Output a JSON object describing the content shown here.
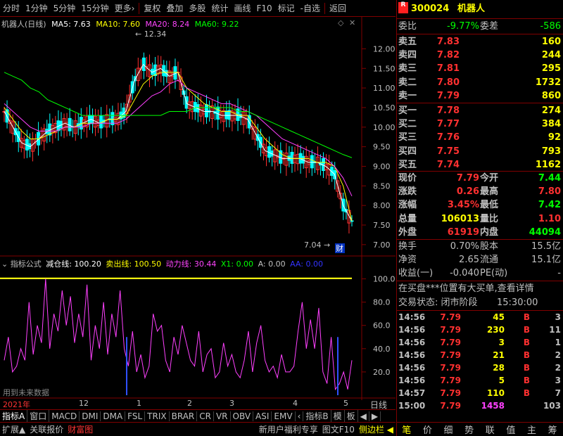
{
  "toolbar": {
    "items": [
      "分时",
      "1分钟",
      "5分钟",
      "15分钟",
      "更多›",
      "复权",
      "叠加",
      "多股",
      "统计",
      "画线",
      "F10",
      "标记",
      "-自选",
      "返回"
    ]
  },
  "chart": {
    "title": "机器人(日线)",
    "ma5": "MA5: 7.63",
    "ma10": "MA10: 7.60",
    "ma20": "MA20: 8.24",
    "ma60": "MA60: 9.22",
    "high_note": "12.34",
    "low_note": "7.04",
    "cai": "财",
    "yticks": [
      "12.00",
      "11.50",
      "11.00",
      "10.50",
      "10.00",
      "9.50",
      "9.00",
      "8.50",
      "8.00",
      "7.50",
      "7.00"
    ],
    "colors": {
      "ma5": "#ffffff",
      "ma10": "#ffff00",
      "ma20": "#ff40ff",
      "ma60": "#00ff00",
      "up": "#ff3030",
      "down": "#00ffff"
    }
  },
  "chart_data": {
    "type": "line",
    "title": "机器人(日线)",
    "ylim": [
      6.8,
      12.6
    ],
    "series": [
      {
        "name": "MA5",
        "values": [
          10.4,
          10.0,
          9.6,
          9.5,
          9.7,
          9.9,
          10.0,
          10.1,
          10.0,
          10.1,
          10.2,
          10.1,
          10.2,
          10.2,
          10.4,
          11.2,
          11.6,
          11.4,
          11.5,
          11.3,
          11.4,
          10.6,
          10.5,
          10.4,
          10.4,
          10.3,
          10.3,
          10.3,
          10.2,
          9.8,
          9.4,
          9.3,
          9.2,
          9.2,
          9.2,
          9.1,
          9.1,
          9.0,
          8.8,
          8.0,
          7.6
        ]
      },
      {
        "name": "MA10",
        "values": [
          10.5,
          10.2,
          9.9,
          9.7,
          9.7,
          9.8,
          9.9,
          10.0,
          10.0,
          10.1,
          10.1,
          10.1,
          10.2,
          10.2,
          10.3,
          10.7,
          11.1,
          11.3,
          11.4,
          11.4,
          11.4,
          11.0,
          10.8,
          10.6,
          10.5,
          10.4,
          10.4,
          10.3,
          10.3,
          10.0,
          9.7,
          9.5,
          9.3,
          9.2,
          9.2,
          9.2,
          9.1,
          9.1,
          9.0,
          8.5,
          7.6
        ]
      },
      {
        "name": "MA20",
        "values": [
          10.6,
          10.4,
          10.2,
          10.0,
          9.9,
          9.9,
          9.9,
          10.0,
          10.0,
          10.0,
          10.1,
          10.1,
          10.1,
          10.1,
          10.2,
          10.4,
          10.6,
          10.8,
          10.9,
          11.1,
          11.2,
          11.0,
          10.9,
          10.8,
          10.7,
          10.6,
          10.6,
          10.5,
          10.4,
          10.3,
          10.1,
          9.9,
          9.7,
          9.6,
          9.5,
          9.4,
          9.3,
          9.2,
          9.0,
          8.7,
          8.24
        ]
      },
      {
        "name": "MA60",
        "values": [
          11.4,
          11.3,
          11.2,
          11.0,
          10.9,
          10.7,
          10.6,
          10.5,
          10.4,
          10.3,
          10.3,
          10.3,
          10.3,
          10.3,
          10.3,
          10.3,
          10.3,
          10.3,
          10.3,
          10.4,
          10.4,
          10.4,
          10.5,
          10.5,
          10.5,
          10.5,
          10.5,
          10.4,
          10.4,
          10.3,
          10.2,
          10.1,
          10.0,
          9.9,
          9.8,
          9.7,
          9.6,
          9.5,
          9.4,
          9.3,
          9.22
        ]
      }
    ]
  },
  "indicator": {
    "label": "指标公式",
    "jc": "减仓线: 100.20",
    "mc": "卖出线: 100.50",
    "dl": "动力线: 30.44",
    "x1": "X1: 0.00",
    "a": "A: 0.00",
    "aa": "AA: 0.00",
    "yticks": [
      "100.0",
      "80.0",
      "60.0",
      "40.0",
      "20.0"
    ],
    "future": "用到未来数据",
    "values": [
      30,
      50,
      20,
      25,
      40,
      30,
      80,
      35,
      60,
      45,
      100,
      40,
      70,
      55,
      90,
      60,
      85,
      45,
      70,
      50,
      95,
      30,
      60,
      40,
      80,
      35,
      70,
      50,
      90,
      40,
      25,
      55,
      20,
      35,
      15,
      25,
      70,
      55,
      60,
      30,
      20,
      50,
      35,
      60,
      45,
      30,
      25,
      55,
      20,
      35,
      40,
      15,
      20,
      45,
      25,
      35,
      20,
      15,
      30,
      55,
      20,
      45,
      60,
      30,
      20,
      25,
      15,
      35,
      20,
      20,
      25,
      55,
      80,
      40,
      65,
      40,
      75,
      20,
      10,
      50,
      5,
      10,
      20,
      5,
      30
    ]
  },
  "xaxis": {
    "year": "2021年",
    "m12": "12",
    "m1": "1",
    "m2": "2",
    "m3": "3",
    "m4": "4",
    "m5": "5",
    "period": "日线"
  },
  "tabs": [
    "指标A",
    "窗口",
    "MACD",
    "DMI",
    "DMA",
    "FSL",
    "TRIX",
    "BRAR",
    "CR",
    "VR",
    "OBV",
    "ASI",
    "EMV",
    "‹",
    "指标B",
    "模",
    "板",
    "◀",
    "▶"
  ],
  "bottom": {
    "items": [
      "扩展▲",
      "关联报价",
      "财富图"
    ],
    "promo": "新用户福利专享",
    "tuwen": "图文F10",
    "cebian": "侧边栏 ◀"
  },
  "bottomright": [
    "笔",
    "价",
    "细",
    "势",
    "联",
    "值",
    "主",
    "筹"
  ],
  "quote": {
    "code": "300024",
    "name": "机器人",
    "webi_label": "委比",
    "webi": "-9.77%",
    "weicha_label": "委差",
    "weicha": "-586",
    "sells": [
      {
        "l": "卖五",
        "p": "7.83",
        "v": "160"
      },
      {
        "l": "卖四",
        "p": "7.82",
        "v": "244"
      },
      {
        "l": "卖三",
        "p": "7.81",
        "v": "295"
      },
      {
        "l": "卖二",
        "p": "7.80",
        "v": "1732"
      },
      {
        "l": "卖一",
        "p": "7.79",
        "v": "860"
      }
    ],
    "buys": [
      {
        "l": "买一",
        "p": "7.78",
        "v": "274"
      },
      {
        "l": "买二",
        "p": "7.77",
        "v": "384"
      },
      {
        "l": "买三",
        "p": "7.76",
        "v": "92"
      },
      {
        "l": "买四",
        "p": "7.75",
        "v": "793"
      },
      {
        "l": "买五",
        "p": "7.74",
        "v": "1162"
      }
    ],
    "stats": [
      {
        "a": "现价",
        "av": "7.79",
        "b": "今开",
        "bv": "7.44"
      },
      {
        "a": "涨跌",
        "av": "0.26",
        "b": "最高",
        "bv": "7.80"
      },
      {
        "a": "涨幅",
        "av": "3.45%",
        "b": "最低",
        "bv": "7.42"
      },
      {
        "a": "总量",
        "av": "106013",
        "b": "量比",
        "bv": "1.10"
      },
      {
        "a": "外盘",
        "av": "61919",
        "b": "内盘",
        "bv": "44094"
      }
    ],
    "stats2": [
      {
        "a": "换手",
        "av": "0.70%",
        "b": "股本",
        "bv": "15.5亿"
      },
      {
        "a": "净资",
        "av": "2.65",
        "b": "流通",
        "bv": "15.1亿"
      },
      {
        "a": "收益(一)",
        "av": "-0.040",
        "b": "PE(动)",
        "bv": "-"
      }
    ],
    "notice": "在买盘***位置有大买单,查看详情",
    "status_label": "交易状态: 闭市阶段",
    "status_time": "15:30:00",
    "ticks": [
      {
        "t": "14:56",
        "p": "7.79",
        "v": "45",
        "s": "B",
        "n": "3"
      },
      {
        "t": "14:56",
        "p": "7.79",
        "v": "230",
        "s": "B",
        "n": "11"
      },
      {
        "t": "14:56",
        "p": "7.79",
        "v": "3",
        "s": "B",
        "n": "1"
      },
      {
        "t": "14:56",
        "p": "7.79",
        "v": "21",
        "s": "B",
        "n": "2"
      },
      {
        "t": "14:56",
        "p": "7.79",
        "v": "28",
        "s": "B",
        "n": "2"
      },
      {
        "t": "14:56",
        "p": "7.79",
        "v": "5",
        "s": "B",
        "n": "3"
      },
      {
        "t": "14:57",
        "p": "7.79",
        "v": "110",
        "s": "B",
        "n": "7"
      },
      {
        "t": "15:00",
        "p": "7.79",
        "v": "1458",
        "s": "",
        "n": "103"
      }
    ]
  }
}
